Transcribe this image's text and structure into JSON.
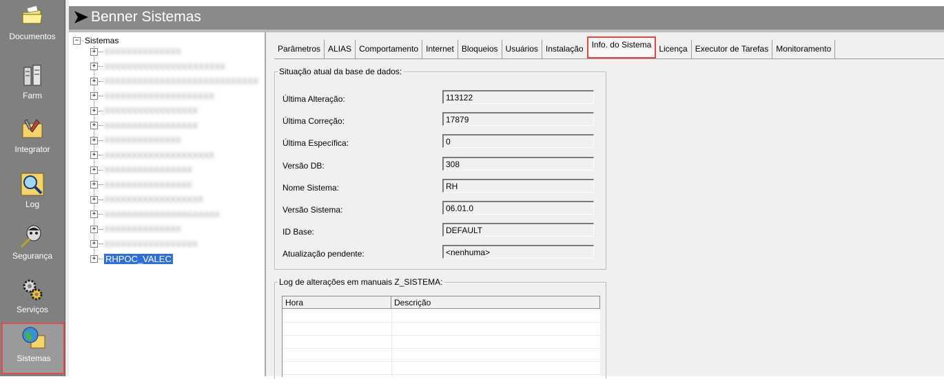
{
  "app": {
    "title": "Benner Sistemas"
  },
  "left_nav": {
    "items": [
      {
        "label": "Documentos",
        "icon": "folder-icon",
        "accel": "D"
      },
      {
        "label": "Farm",
        "icon": "server-icon",
        "accel": "F"
      },
      {
        "label": "Integrator",
        "icon": "tools-icon",
        "accel": "I"
      },
      {
        "label": "Log",
        "icon": "magnifier-icon",
        "accel": "L"
      },
      {
        "label": "Segurança",
        "icon": "security-icon",
        "accel": "S"
      },
      {
        "label": "Serviços",
        "icon": "gears-icon",
        "accel": "v"
      },
      {
        "label": "Sistemas",
        "icon": "globe-folder-icon",
        "accel": "t"
      }
    ],
    "selected": "Sistemas"
  },
  "tree": {
    "root_label": "Sistemas",
    "selected_node": "RHPOC_VALEC",
    "blurred_nodes": [
      "XXXXXXXXXXXXXX",
      "XXXXXXXXXXXXXXXXXXXXXX",
      "XXXXXXXXXXXXXXXXXXXXXXXXXXXX",
      "XXXXXXXXXXXXXXXXXXXX",
      "XXXXXXXXXXXXXXXXX",
      "XXXXXXXXXXXXXXXXX",
      "XXXXXXXXXXXXXX",
      "XXXXXXXXXXXXXXXXXXXX",
      "XXXXXXXXXXXXXXXX",
      "XXXXXXXXXXXXXXXX",
      "XXXXXXXXXXXXXXXXXX",
      "XXXXXXXXXXXXXXXXXXXXX",
      "XXXXXXXXXXXXXX",
      "XXXXXXXXXXXXXXXXX"
    ]
  },
  "tabs": {
    "items": [
      "Parâmetros",
      "ALIAS",
      "Comportamento",
      "Internet",
      "Bloqueios",
      "Usuários",
      "Instalação",
      "Info. do Sistema",
      "Licença",
      "Executor de Tarefas",
      "Monitoramento"
    ],
    "active": "Info. do Sistema"
  },
  "status_group": {
    "title": "Situação atual da base de dados:",
    "fields": [
      {
        "label": "Última Alteração:",
        "value": "113122"
      },
      {
        "label": "Última Correção:",
        "value": "17879"
      },
      {
        "label": "Última Específica:",
        "value": "0"
      },
      {
        "label": "Versão DB:",
        "value": "308"
      },
      {
        "label": "Nome Sistema:",
        "value": "RH"
      },
      {
        "label": "Versão Sistema:",
        "value": "06.01.0"
      },
      {
        "label": "ID Base:",
        "value": "DEFAULT"
      },
      {
        "label": "Atualização pendente:",
        "value": "<nenhuma>"
      }
    ]
  },
  "log_group": {
    "title": "Log de alterações em manuais Z_SISTEMA:",
    "columns": [
      "Hora",
      "Descrição"
    ],
    "rows": []
  },
  "colors": {
    "sidebar_bg": "#808080",
    "title_bar_bg": "#8a8a8a",
    "selection_blue": "#2f6fd6",
    "highlight_red": "#e04646"
  }
}
